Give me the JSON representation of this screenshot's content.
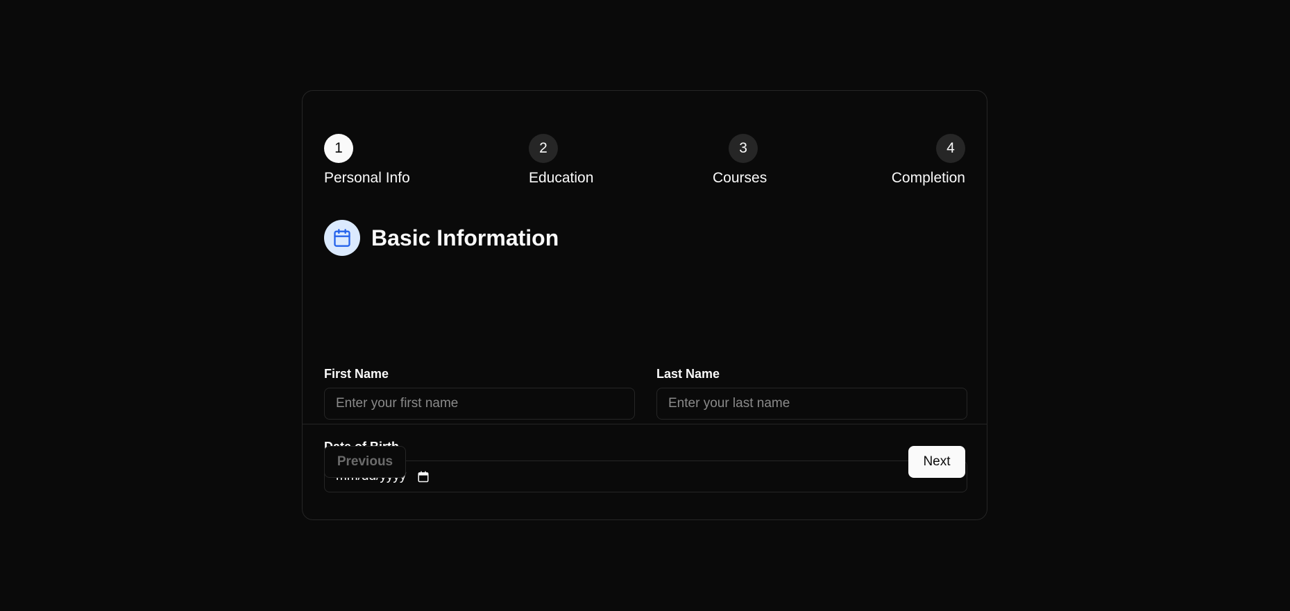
{
  "stepper": {
    "steps": [
      {
        "number": "1",
        "label": "Personal Info",
        "active": true
      },
      {
        "number": "2",
        "label": "Education",
        "active": false
      },
      {
        "number": "3",
        "label": "Courses",
        "active": false
      },
      {
        "number": "4",
        "label": "Completion",
        "active": false
      }
    ]
  },
  "section": {
    "icon": "calendar-icon",
    "title": "Basic Information"
  },
  "form": {
    "first_name": {
      "label": "First Name",
      "placeholder": "Enter your first name",
      "value": ""
    },
    "last_name": {
      "label": "Last Name",
      "placeholder": "Enter your last name",
      "value": ""
    },
    "dob": {
      "label": "Date of Birth",
      "placeholder": "mm/dd/yyyy",
      "icon": "calendar-picker-icon"
    }
  },
  "nav": {
    "previous_label": "Previous",
    "next_label": "Next"
  },
  "colors": {
    "background": "#0a0a0a",
    "border": "#262626",
    "icon_bg": "#dbeafe",
    "icon_accent": "#2563eb",
    "primary_button": "#fafafa"
  }
}
